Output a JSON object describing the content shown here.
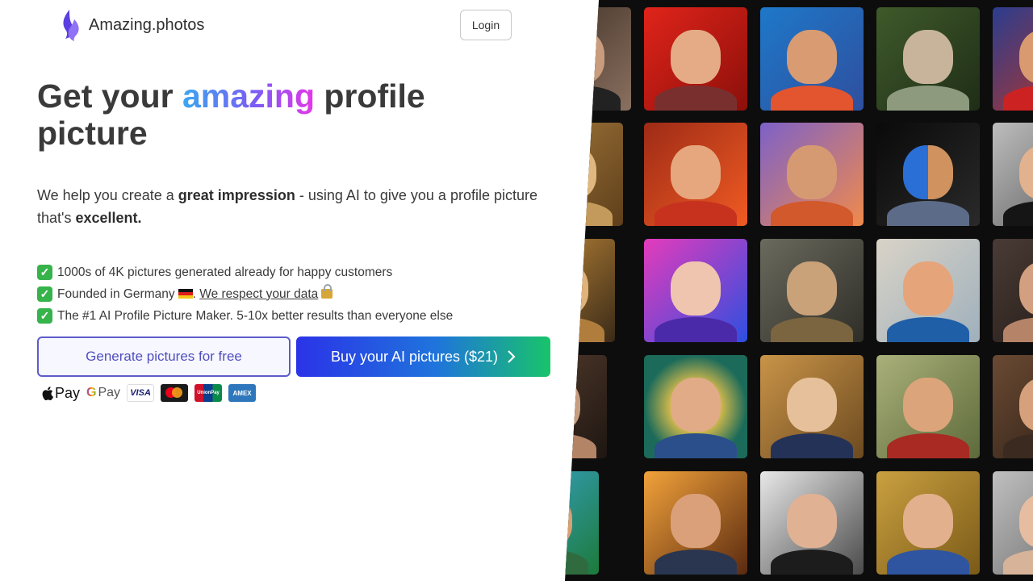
{
  "brand": {
    "name": "Amazing.photos"
  },
  "header": {
    "login_label": "Login"
  },
  "hero": {
    "title_start": "Get your ",
    "title_highlight": "amazing",
    "title_end": " profile picture",
    "sub_1": "We help you create a ",
    "sub_bold_1": "great impression",
    "sub_2": " - using AI to give you a profile picture that's ",
    "sub_bold_2": "excellent."
  },
  "bullets": {
    "b1": "1000s of 4K pictures generated already for happy customers",
    "b2_text": "Founded in Germany",
    "b2_sep": ".",
    "b2_link": "We respect your data",
    "b3": "The #1 AI Profile Picture Maker. 5-10x better results than everyone else"
  },
  "cta": {
    "free_label": "Generate pictures for free",
    "buy_label": "Buy your AI pictures ($21)"
  },
  "payments": {
    "apple": "Pay",
    "google": "Pay",
    "visa": "VISA",
    "unionpay": "UnionPay",
    "amex": "AMEX"
  },
  "colors": {
    "accent_purple": "#5e5cc9",
    "buy_gradient_start": "#2b33e8",
    "buy_gradient_end": "#18c46a",
    "check_green": "#36b34a"
  },
  "icons": [
    "logo-flame-icon",
    "check-icon",
    "germany-flag-icon",
    "lock-icon",
    "chevron-right-icon",
    "apple-icon",
    "google-g-icon",
    "visa-icon",
    "mastercard-icon",
    "unionpay-icon",
    "amex-icon"
  ]
}
